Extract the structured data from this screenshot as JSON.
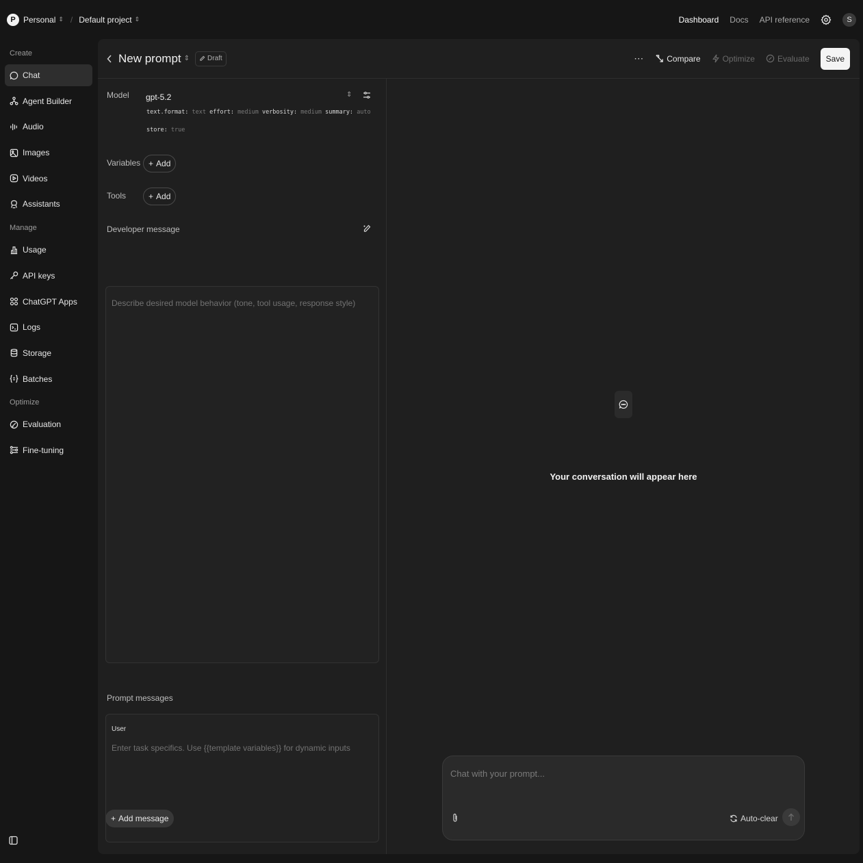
{
  "topbar": {
    "org_initial": "P",
    "org_name": "Personal",
    "separator": "/",
    "project_name": "Default project",
    "links": [
      "Dashboard",
      "Docs",
      "API reference"
    ],
    "user_initial": "S"
  },
  "sidebar": {
    "sections": [
      {
        "title": "Create",
        "items": [
          {
            "label": "Chat",
            "icon": "chat-bubble-icon",
            "active": true
          },
          {
            "label": "Agent Builder",
            "icon": "agent-icon"
          },
          {
            "label": "Audio",
            "icon": "audio-wave-icon"
          },
          {
            "label": "Images",
            "icon": "image-icon"
          },
          {
            "label": "Videos",
            "icon": "play-icon"
          },
          {
            "label": "Assistants",
            "icon": "assistant-icon"
          }
        ]
      },
      {
        "title": "Manage",
        "items": [
          {
            "label": "Usage",
            "icon": "usage-chart-icon"
          },
          {
            "label": "API keys",
            "icon": "key-icon"
          },
          {
            "label": "ChatGPT Apps",
            "icon": "apps-grid-icon"
          },
          {
            "label": "Logs",
            "icon": "terminal-icon"
          },
          {
            "label": "Storage",
            "icon": "database-icon"
          },
          {
            "label": "Batches",
            "icon": "braces-icon"
          }
        ]
      },
      {
        "title": "Optimize",
        "items": [
          {
            "label": "Evaluation",
            "icon": "evaluation-icon"
          },
          {
            "label": "Fine-tuning",
            "icon": "fine-tuning-icon"
          }
        ]
      }
    ]
  },
  "header": {
    "title": "New prompt",
    "badge": "Draft",
    "compare": "Compare",
    "optimize": "Optimize",
    "evaluate": "Evaluate",
    "save": "Save"
  },
  "config": {
    "model_label": "Model",
    "model_name": "gpt-5.2",
    "params_line1": [
      {
        "key": "text.format:",
        "value": "text"
      },
      {
        "key": "effort:",
        "value": "medium"
      },
      {
        "key": "verbosity:",
        "value": "medium"
      },
      {
        "key": "summary:",
        "value": "auto"
      }
    ],
    "params_line2": [
      {
        "key": "store:",
        "value": "true"
      }
    ],
    "variables_label": "Variables",
    "tools_label": "Tools",
    "add_label": "Add",
    "developer_label": "Developer message",
    "developer_placeholder": "Describe desired model behavior (tone, tool usage, response style)",
    "prompt_messages_label": "Prompt messages",
    "user_role": "User",
    "user_placeholder": "Enter task specifics. Use {{template variables}} for dynamic inputs",
    "add_message": "Add message"
  },
  "conversation": {
    "empty_text": "Your conversation will appear here",
    "chat_placeholder": "Chat with your prompt...",
    "auto_clear": "Auto-clear"
  }
}
